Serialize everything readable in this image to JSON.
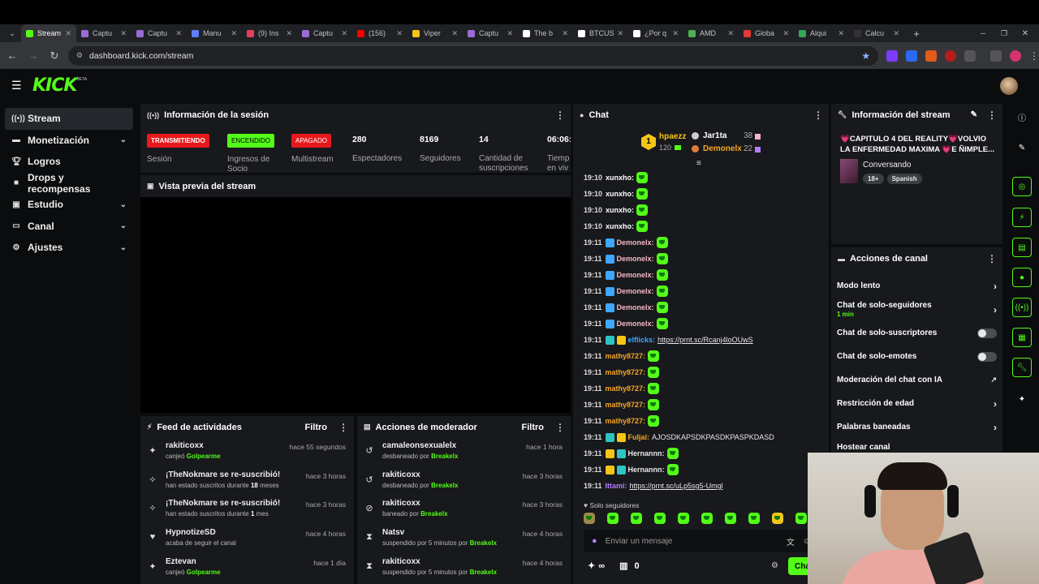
{
  "browser": {
    "tabs": [
      {
        "label": "Stream",
        "color": "#53fc18"
      },
      {
        "label": "Captu",
        "color": "#9b6bd6"
      },
      {
        "label": "Captu",
        "color": "#9b6bd6"
      },
      {
        "label": "Manu",
        "color": "#5f7fff"
      },
      {
        "label": "(9) Ins",
        "color": "#e4405f"
      },
      {
        "label": "Captu",
        "color": "#9b6bd6"
      },
      {
        "label": "(156)",
        "color": "#ff0000"
      },
      {
        "label": "Viper",
        "color": "#f5c518"
      },
      {
        "label": "Captu",
        "color": "#9b6bd6"
      },
      {
        "label": "The b",
        "color": "#ffffff"
      },
      {
        "label": "BTCUS",
        "color": "#ffffff"
      },
      {
        "label": "¿Por q",
        "color": "#ffffff"
      },
      {
        "label": "AMD",
        "color": "#4caf50"
      },
      {
        "label": "Globa",
        "color": "#e53935"
      },
      {
        "label": "Alqui",
        "color": "#34a853"
      },
      {
        "label": "Calcu",
        "color": "#333333"
      }
    ],
    "url": "dashboard.kick.com/stream",
    "new_tab": "+"
  },
  "kick": {
    "logo": "KICK",
    "beta": "BETA"
  },
  "sidebar": {
    "items": [
      {
        "label": "Stream",
        "icon": "broadcast-icon"
      },
      {
        "label": "Monetización",
        "icon": "money-icon"
      },
      {
        "label": "Logros",
        "icon": "trophy-icon"
      },
      {
        "label": "Drops y recompensas",
        "icon": "gift-icon"
      },
      {
        "label": "Estudio",
        "icon": "studio-icon"
      },
      {
        "label": "Canal",
        "icon": "channel-icon"
      },
      {
        "label": "Ajustes",
        "icon": "gear-icon"
      }
    ]
  },
  "session": {
    "title": "Información de la sesión",
    "badges": [
      {
        "label": "TRANSMITIENDO",
        "sub": "Sesión",
        "bg": "#e8191c",
        "fg": "#ffffff"
      },
      {
        "label": "ENCENDIDO",
        "sub": "Ingresos de Socio",
        "bg": "#53fc18",
        "fg": "#000000"
      },
      {
        "label": "APAGADO",
        "sub": "Multistream",
        "bg": "#e8191c",
        "fg": "#ffffff"
      }
    ],
    "stats": [
      {
        "value": "280",
        "label": "Espectadores"
      },
      {
        "value": "8169",
        "label": "Seguidores"
      },
      {
        "value": "14",
        "label": "Cantidad de suscripciones"
      },
      {
        "value": "06:06:",
        "label": "Tiemp en viv"
      }
    ]
  },
  "preview": {
    "title": "Vista previa del stream"
  },
  "activity": {
    "title": "Feed de actividades",
    "filter": "Filtro",
    "rows": [
      {
        "user": "rakiticoxx",
        "pre": "canjeó ",
        "hl": "Golpearme",
        "post": "",
        "time": "hace 55 segundos",
        "icon": "kick-coin-icon"
      },
      {
        "user": "¡TheNokmare se re-suscribió!",
        "pre": "han estado suscritos durante ",
        "hl": "18",
        "post": " meses",
        "time": "hace 3 horas",
        "icon": "sparkle-icon"
      },
      {
        "user": "¡TheNokmare se re-suscribió!",
        "pre": "han estado suscritos durante ",
        "hl": "1",
        "post": " mes",
        "time": "hace 3 horas",
        "icon": "sparkle-icon"
      },
      {
        "user": "HypnotizeSD",
        "pre": "acaba de seguir el canal",
        "hl": "",
        "post": "",
        "time": "hace 4 horas",
        "icon": "heart-icon"
      },
      {
        "user": "Eztevan",
        "pre": "canjeó ",
        "hl": "Golpearme",
        "post": "",
        "time": "hace 1 día",
        "icon": "kick-coin-icon"
      }
    ]
  },
  "moderation": {
    "title": "Acciones de moderador",
    "filter": "Filtro",
    "rows": [
      {
        "user": "camaleonsexualelx",
        "pre": "desbaneado por ",
        "by": "Breakelx",
        "time": "hace 1 hora",
        "icon": "undo-icon"
      },
      {
        "user": "rakiticoxx",
        "pre": "desbaneado por ",
        "by": "Breakelx",
        "time": "hace 3 horas",
        "icon": "undo-icon"
      },
      {
        "user": "rakiticoxx",
        "pre": "baneado por ",
        "by": "Breakelx",
        "time": "hace 3 horas",
        "icon": "ban-icon"
      },
      {
        "user": "Natsv",
        "pre": "suspendido por 5 minutos por ",
        "by": "Breakelx",
        "time": "hace 4 horas",
        "icon": "hourglass-icon"
      },
      {
        "user": "rakiticoxx",
        "pre": "suspendido por 5 minutos por ",
        "by": "Breakelx",
        "time": "hace 4 horas",
        "icon": "hourglass-icon"
      }
    ]
  },
  "chat": {
    "title": "Chat",
    "top": [
      {
        "rank": "1",
        "name": "hpaezz",
        "count": "120",
        "color": "#f5c518"
      },
      {
        "rank": "",
        "name": "Jar1ta",
        "count": "38",
        "color": "#ffffff"
      },
      {
        "rank": "",
        "name": "Demonelx",
        "count": "22",
        "color": "#f5a623"
      }
    ],
    "messages": [
      {
        "time": "19:10",
        "user": "xunxho:",
        "color": "#ffffff",
        "text": "",
        "emote": true,
        "badges": []
      },
      {
        "time": "19:10",
        "user": "xunxho:",
        "color": "#ffffff",
        "text": "",
        "emote": true,
        "badges": []
      },
      {
        "time": "19:10",
        "user": "xunxho:",
        "color": "#ffffff",
        "text": "",
        "emote": true,
        "badges": []
      },
      {
        "time": "19:10",
        "user": "xunxho:",
        "color": "#ffffff",
        "text": "",
        "emote": true,
        "badges": []
      },
      {
        "time": "19:11",
        "user": "Demonelx:",
        "color": "#f5b7c6",
        "text": "",
        "emote": true,
        "badges": [
          "#3fa7ff"
        ]
      },
      {
        "time": "19:11",
        "user": "Demonelx:",
        "color": "#f5b7c6",
        "text": "",
        "emote": true,
        "badges": [
          "#3fa7ff"
        ]
      },
      {
        "time": "19:11",
        "user": "Demonelx:",
        "color": "#f5b7c6",
        "text": "",
        "emote": true,
        "badges": [
          "#3fa7ff"
        ]
      },
      {
        "time": "19:11",
        "user": "Demonelx:",
        "color": "#f5b7c6",
        "text": "",
        "emote": true,
        "badges": [
          "#3fa7ff"
        ]
      },
      {
        "time": "19:11",
        "user": "Demonelx:",
        "color": "#f5b7c6",
        "text": "",
        "emote": true,
        "badges": [
          "#3fa7ff"
        ]
      },
      {
        "time": "19:11",
        "user": "Demonelx:",
        "color": "#f5b7c6",
        "text": "",
        "emote": true,
        "badges": [
          "#3fa7ff"
        ]
      },
      {
        "time": "19:11",
        "user": "elflicks:",
        "color": "#3fa7ff",
        "text": "https://prnt.sc/Rcanj4loOUwS",
        "link": true,
        "emote": false,
        "badges": [
          "#2ec4c4",
          "#f5c518"
        ]
      },
      {
        "time": "19:11",
        "user": "mathy8727:",
        "color": "#f5a623",
        "text": "",
        "emote": true,
        "badges": []
      },
      {
        "time": "19:11",
        "user": "mathy8727:",
        "color": "#f5a623",
        "text": "",
        "emote": true,
        "badges": []
      },
      {
        "time": "19:11",
        "user": "mathy8727:",
        "color": "#f5a623",
        "text": "",
        "emote": true,
        "badges": []
      },
      {
        "time": "19:11",
        "user": "mathy8727:",
        "color": "#f5a623",
        "text": "",
        "emote": true,
        "badges": []
      },
      {
        "time": "19:11",
        "user": "mathy8727:",
        "color": "#f5a623",
        "text": "",
        "emote": true,
        "badges": []
      },
      {
        "time": "19:11",
        "user": "Fuljai:",
        "color": "#f5a623",
        "text": "AJOSDKAPSDKPASDKPASPKDASD",
        "emote": false,
        "badges": [
          "#2ec4c4",
          "#f5c518"
        ]
      },
      {
        "time": "19:11",
        "user": "Hernannn:",
        "color": "#e8e8e8",
        "text": "",
        "emote": true,
        "badges": [
          "#f5c518",
          "#2ec4c4"
        ]
      },
      {
        "time": "19:11",
        "user": "Hernannn:",
        "color": "#e8e8e8",
        "text": "",
        "emote": true,
        "badges": [
          "#f5c518",
          "#2ec4c4"
        ]
      },
      {
        "time": "19:11",
        "user": "Ittami:",
        "color": "#b57bff",
        "text": "https://prnt.sc/uLp5sg5-Umgl",
        "link": true,
        "emote": false,
        "badges": []
      }
    ],
    "mode": "Solo seguidores",
    "input_placeholder": "Enviar un mensaje",
    "kick_coins": "∞",
    "chests": "0",
    "send": "Chat"
  },
  "stream_info": {
    "title": "Información del stream",
    "stream_title": "💗CAPITULO 4 DEL REALITY💗VOLVIO LA ENFERMEDAD MAXIMA 💗E ÑIMPLE...",
    "category": "Conversando",
    "tags": [
      "18+",
      "Spanish"
    ]
  },
  "channel_actions": {
    "title": "Acciones de canal",
    "rows": [
      {
        "label": "Modo lento",
        "sub": "",
        "type": "chevron"
      },
      {
        "label": "Chat de solo-seguidores",
        "sub": "1 min",
        "type": "chevron"
      },
      {
        "label": "Chat de solo-suscriptores",
        "sub": "",
        "type": "toggle"
      },
      {
        "label": "Chat de solo-emotes",
        "sub": "",
        "type": "toggle"
      },
      {
        "label": "Moderación del chat con IA",
        "sub": "",
        "type": "external"
      },
      {
        "label": "Restricción de edad",
        "sub": "",
        "type": "chevron"
      },
      {
        "label": "Palabras baneadas",
        "sub": "",
        "type": "chevron"
      },
      {
        "label": "Hostear canal",
        "sub": "",
        "type": "none"
      }
    ]
  },
  "colors": {
    "accent": "#53fc18",
    "live": "#e8191c",
    "panel": "#18191c"
  }
}
